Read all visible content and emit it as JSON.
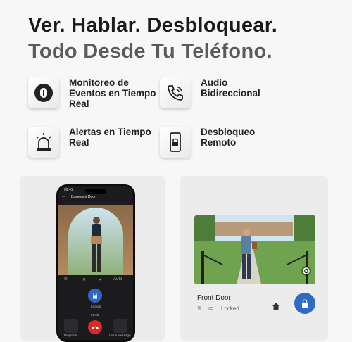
{
  "headline": {
    "line1": "Ver. Hablar. Desbloquear.",
    "line2": "Todo Desde Tu Teléfono."
  },
  "features": [
    {
      "icon": "doorbell-icon",
      "label": "Monitoreo de Eventos en Tiempo Real"
    },
    {
      "icon": "phone-call-icon",
      "label": "Audio Bidireccional"
    },
    {
      "icon": "alarm-light-icon",
      "label": "Alertas en Tiempo Real"
    },
    {
      "icon": "phone-lock-icon",
      "label": "Desbloqueo Remoto"
    }
  ],
  "phone_app": {
    "status_time": "09:41",
    "title": "Basement Door",
    "zoom_label": "Auto",
    "lock_status": "Locked",
    "call_timer": "00:09",
    "left_action": "Ringtone",
    "right_action": "Voice Message"
  },
  "front_door": {
    "name": "Front Door",
    "lock_status": "Locked"
  },
  "colors": {
    "accent": "#2f6bc4",
    "end_call": "#d92a2a",
    "card_bg": "#ececec"
  }
}
